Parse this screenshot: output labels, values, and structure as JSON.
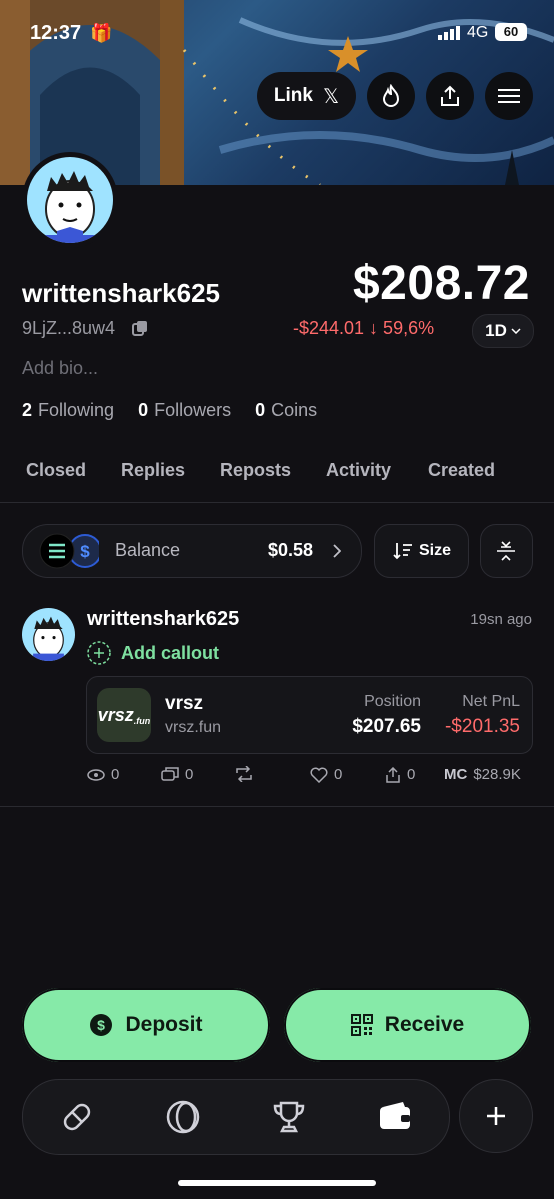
{
  "status": {
    "time": "12:37",
    "network": "4G",
    "battery": "60"
  },
  "header": {
    "link_label": "Link"
  },
  "profile": {
    "username": "writtenshark625",
    "address": "9LjZ...8uw4",
    "balance": "$208.72",
    "change": "-$244.01 ↓ 59,6%",
    "range": "1D",
    "bio_placeholder": "Add bio...",
    "following_count": "2",
    "following_label": "Following",
    "followers_count": "0",
    "followers_label": "Followers",
    "coins_count": "0",
    "coins_label": "Coins"
  },
  "tabs": [
    "Closed",
    "Replies",
    "Reposts",
    "Activity",
    "Created"
  ],
  "balance_bar": {
    "label": "Balance",
    "value": "$0.58",
    "size_label": "Size"
  },
  "post": {
    "username": "writtenshark625",
    "time_ago": "19sn ago",
    "callout_label": "Add callout",
    "coin": {
      "logo_text": "vrsz",
      "logo_sub": ".fun",
      "name": "vrsz",
      "site": "vrsz.fun",
      "position_label": "Position",
      "position_value": "$207.65",
      "pnl_label": "Net PnL",
      "pnl_value": "-$201.35"
    },
    "views": "0",
    "comments": "0",
    "likes": "0",
    "shares": "0",
    "mc_label": "MC",
    "mc_value": "$28.9K"
  },
  "actions": {
    "deposit": "Deposit",
    "receive": "Receive"
  },
  "colors": {
    "accent": "#86eaa8",
    "negative": "#ff6b6b",
    "background": "#111014"
  }
}
